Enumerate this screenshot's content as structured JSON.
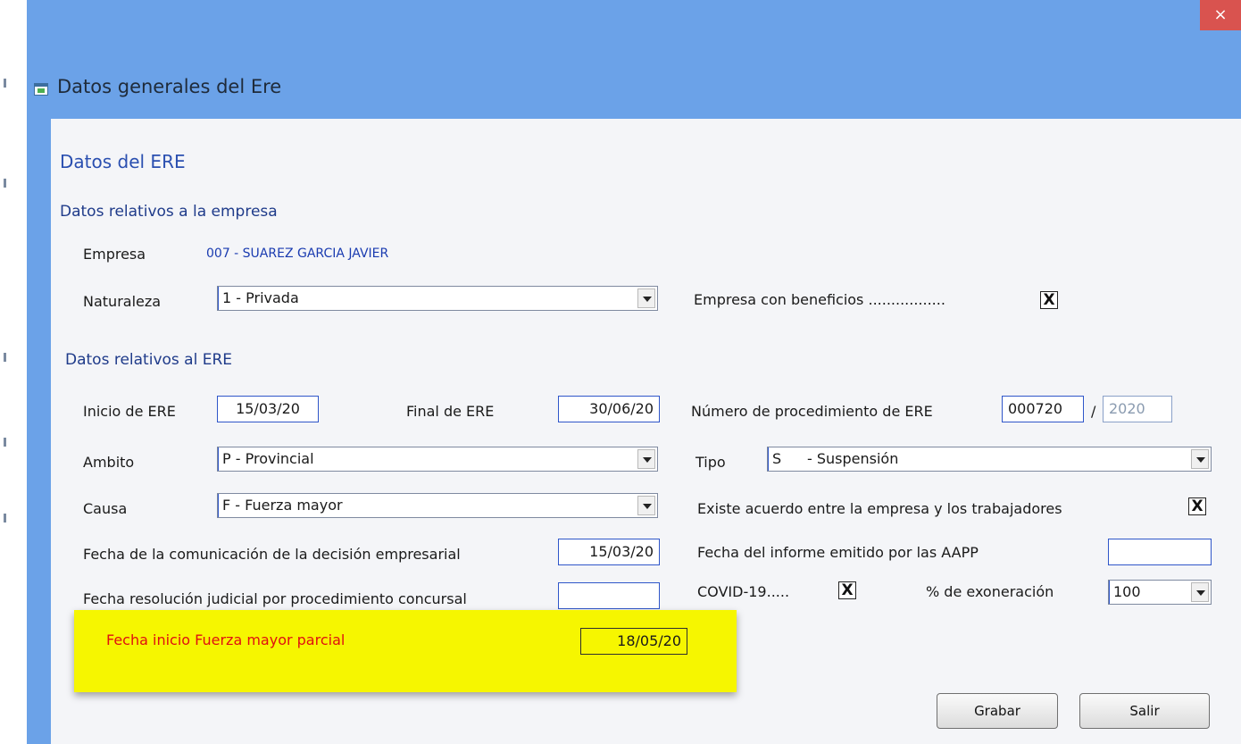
{
  "window": {
    "title": "Datos generales del Ere",
    "close_label": "×"
  },
  "form": {
    "section_title": "Datos del ERE",
    "empresa_section": "Datos relativos a la empresa",
    "empresa_label": "Empresa",
    "empresa_value": "007 - SUAREZ GARCIA JAVIER",
    "naturaleza_label": "Naturaleza",
    "naturaleza_value": "1 - Privada",
    "beneficios_label": "Empresa con beneficios .................",
    "beneficios_checked": "X",
    "ere_section": "Datos relativos al ERE",
    "inicio_label": "Inicio de ERE",
    "inicio_value": "15/03/20",
    "final_label": "Final de ERE",
    "final_value": "30/06/20",
    "num_proc_label": "Número de procedimiento de ERE",
    "num_proc_value": "000720",
    "num_proc_sep": "/",
    "num_proc_year": "2020",
    "ambito_label": "Ambito",
    "ambito_value": "P - Provincial",
    "tipo_label": "Tipo",
    "tipo_code": "S",
    "tipo_value": "- Suspensión",
    "causa_label": "Causa",
    "causa_value": "F - Fuerza mayor",
    "acuerdo_label": "Existe acuerdo entre la empresa y los trabajadores",
    "acuerdo_checked": "X",
    "fecha_com_label": "Fecha de la comunicación de la decisión empresarial",
    "fecha_com_value": "15/03/20",
    "fecha_informe_label": "Fecha del informe emitido por las AAPP",
    "fecha_informe_value": "",
    "fecha_resol_label": "Fecha resolución judicial por procedimiento concursal",
    "fecha_resol_value": "",
    "covid_label": "COVID-19.....",
    "covid_checked": "X",
    "exoneracion_label": "% de exoneración",
    "exoneracion_value": "100",
    "fm_parcial_label": "Fecha inicio Fuerza mayor parcial",
    "fm_parcial_value": "18/05/20"
  },
  "buttons": {
    "grabar": "Grabar",
    "salir": "Salir"
  },
  "colors": {
    "titlebar": "#6ba2e8",
    "close": "#d9534f",
    "highlight": "#f6f600",
    "highlight_text": "#e01010"
  }
}
